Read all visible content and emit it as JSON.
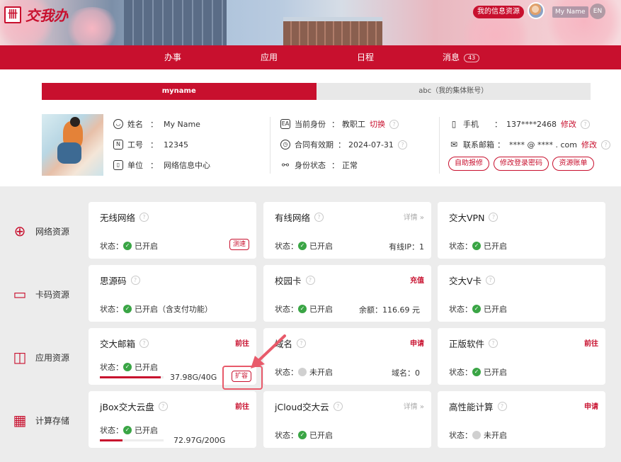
{
  "header": {
    "logo_text": "交我办",
    "my_info_label": "我的信息资源",
    "username": "My Name",
    "lang": "EN"
  },
  "nav": {
    "items": [
      {
        "label": "办事"
      },
      {
        "label": "应用"
      },
      {
        "label": "日程"
      },
      {
        "label": "消息",
        "badge": "43"
      }
    ]
  },
  "accounts": {
    "tabs": [
      {
        "label": "myname",
        "active": true
      },
      {
        "label": "abc（我的集体账号）",
        "active": false
      }
    ]
  },
  "profile": {
    "name_label": "姓名",
    "name_value": "My Name",
    "id_label": "工号",
    "id_value": "12345",
    "unit_label": "单位",
    "unit_value": "网络信息中心",
    "identity_label": "当前身份",
    "identity_value": "教职工",
    "identity_switch": "切换",
    "contract_label": "合同有效期",
    "contract_value": "2024-07-31",
    "status_label": "身份状态",
    "status_value": "正常",
    "phone_label": "手机",
    "phone_value": "137****2468",
    "phone_edit": "修改",
    "email_label": "联系邮箱",
    "email_value": "**** @ **** . com",
    "email_edit": "修改",
    "buttons": [
      "自助报修",
      "修改登录密码",
      "资源账单"
    ]
  },
  "categories": [
    {
      "label": "网络资源",
      "icon": "globe-icon"
    },
    {
      "label": "卡码资源",
      "icon": "card-icon"
    },
    {
      "label": "应用资源",
      "icon": "apps-icon"
    },
    {
      "label": "计算存储",
      "icon": "calculator-icon"
    }
  ],
  "status_label": "状态：",
  "cards": {
    "wifi": {
      "title": "无线网络",
      "status": "已开启",
      "btn": "测速"
    },
    "wired": {
      "title": "有线网络",
      "action": "详情",
      "status": "已开启",
      "right": "有线IP：1"
    },
    "vpn": {
      "title": "交大VPN",
      "status": "已开启"
    },
    "siyuan": {
      "title": "思源码",
      "status": "已开启（含支付功能）"
    },
    "campus_card": {
      "title": "校园卡",
      "action": "充值",
      "status": "已开启",
      "right": "余额：116.69 元"
    },
    "vcard": {
      "title": "交大V卡",
      "status": "已开启"
    },
    "mail": {
      "title": "交大邮箱",
      "action": "前往",
      "status": "已开启",
      "quota": "37.98G/40G",
      "used_fraction": 0.95,
      "btn": "扩容"
    },
    "domain": {
      "title": "域名",
      "action": "申请",
      "status": "未开启",
      "right": "域名：0"
    },
    "software": {
      "title": "正版软件",
      "action": "前往",
      "status": "已开启"
    },
    "jbox": {
      "title": "jBox交大云盘",
      "action": "前往",
      "status": "已开启",
      "quota": "72.97G/200G",
      "used_fraction": 0.36
    },
    "jcloud": {
      "title": "jCloud交大云",
      "action": "详情",
      "status": "已开启"
    },
    "hpc": {
      "title": "高性能计算",
      "action": "申请",
      "status": "未开启"
    }
  },
  "colors": {
    "brand": "#c8102e",
    "status_on": "#3aa545",
    "status_off": "#d0d0d0"
  }
}
